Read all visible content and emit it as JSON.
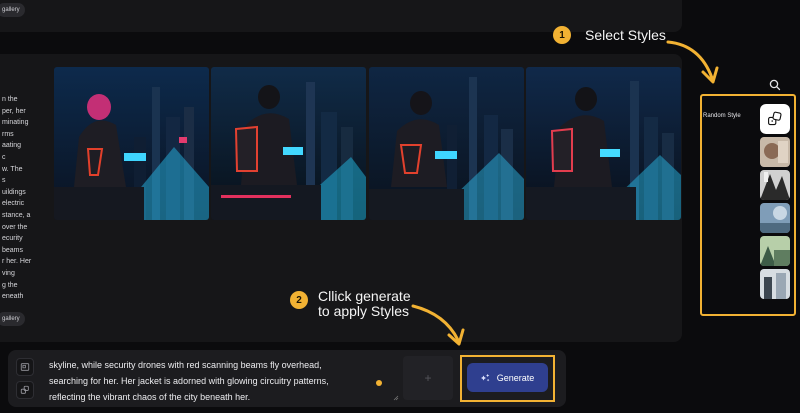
{
  "gallery": {
    "top_label": "gallery",
    "bottom_label": "gallery"
  },
  "prompt_snippet": "n the\nper, her\nminating\nrms\naating\nc\nw. The\ns\nuildings\nelectric\nstance, a\nover the\necurity\nbeams\nr her. Her\nving\ng the\neneath",
  "images": [
    {
      "name": "cyberpunk-girl-1"
    },
    {
      "name": "cyberpunk-girl-2"
    },
    {
      "name": "cyberpunk-girl-3"
    },
    {
      "name": "cyberpunk-girl-4"
    }
  ],
  "annotations": {
    "step1": {
      "number": "1",
      "text": "Select Styles"
    },
    "step2": {
      "number": "2",
      "line1": "Cllick generate",
      "line2": "to apply Styles"
    }
  },
  "styles": {
    "random_label": "Random Style",
    "random_icon": "random-dice-icon",
    "thumbs": [
      {
        "name": "style-painting",
        "colors": [
          "#c8b9a8",
          "#8a6a55",
          "#e0d3c4"
        ]
      },
      {
        "name": "style-monochrome",
        "colors": [
          "#d0d0d0",
          "#2a2a2a",
          "#f0f0f0"
        ]
      },
      {
        "name": "style-fantasy",
        "colors": [
          "#7f9db8",
          "#c8d7e4",
          "#4e6a80"
        ]
      },
      {
        "name": "style-nature",
        "colors": [
          "#5f7d60",
          "#b7cfa9",
          "#3d5c47"
        ]
      },
      {
        "name": "style-urban",
        "colors": [
          "#9aa7b4",
          "#3c4650",
          "#d7dde2"
        ]
      }
    ]
  },
  "prompt": {
    "line1": "skyline, while security drones with red scanning beams fly overhead,",
    "line2": "searching for her. Her jacket is adorned with glowing circuitry patterns,",
    "line3": "reflecting the vibrant chaos of the city beneath her."
  },
  "add_label": "+",
  "generate_label": "Generate",
  "colors": {
    "accent": "#f2b233",
    "generate": "#2f3f8f"
  }
}
